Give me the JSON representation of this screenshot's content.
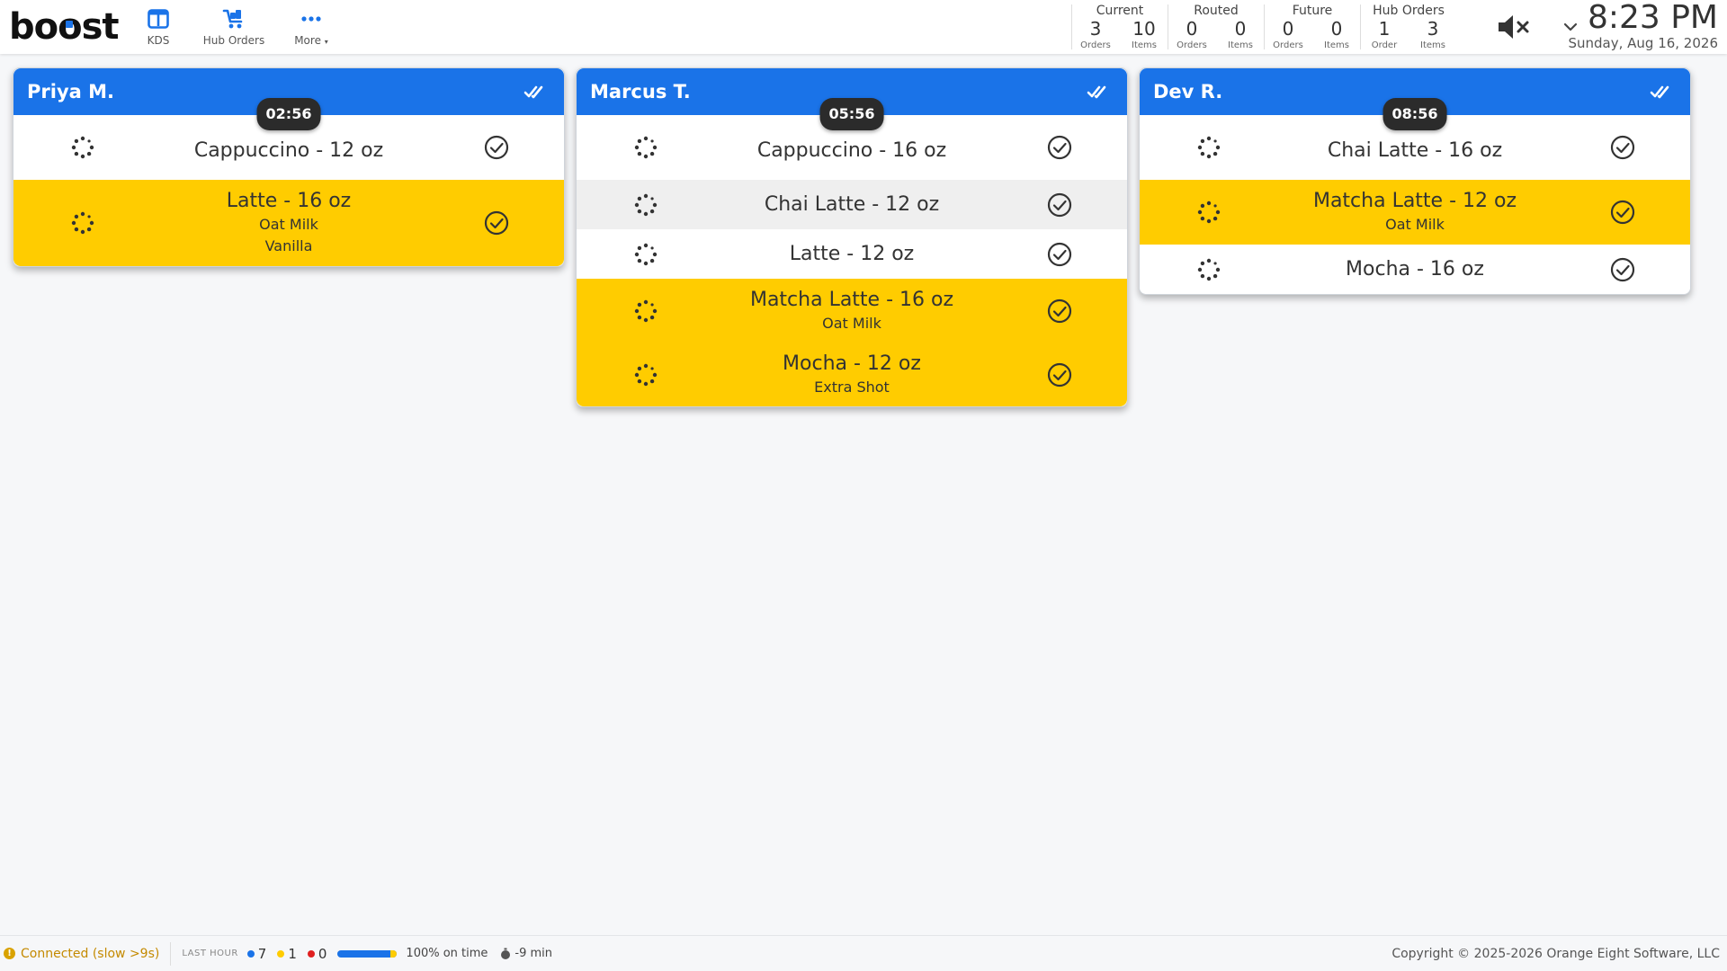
{
  "brand": {
    "logo_prefix": "b",
    "logo_o1": "o",
    "logo_o2": "o",
    "logo_suffix": "st",
    "accent": "#1a73e8"
  },
  "nav": [
    {
      "label": "KDS",
      "icon": "kds-icon"
    },
    {
      "label": "Hub Orders",
      "icon": "cart-icon"
    },
    {
      "label": "More",
      "icon": "more-dots-icon",
      "has_caret": true
    }
  ],
  "stats": {
    "current": {
      "title": "Current",
      "orders": "3",
      "orders_label": "Orders",
      "items": "10",
      "items_label": "Items"
    },
    "routed": {
      "title": "Routed",
      "orders": "0",
      "orders_label": "Orders",
      "items": "0",
      "items_label": "Items"
    },
    "future": {
      "title": "Future",
      "orders": "0",
      "orders_label": "Orders",
      "items": "0",
      "items_label": "Items"
    },
    "hub": {
      "title": "Hub Orders",
      "orders": "1",
      "orders_label": "Order",
      "items": "3",
      "items_label": "Items"
    }
  },
  "clock": {
    "time": "8:23 PM",
    "date": "Sunday, Aug 16, 2026"
  },
  "colors": {
    "header_blue": "#1a73e8",
    "modifier_yellow": "#ffcc00",
    "alt_row": "#efefef",
    "timer_bg": "#2b2b2b"
  },
  "orders": [
    {
      "name": "Priya M.",
      "timer": "02:56",
      "items": [
        {
          "name": "Cappuccino - 12 oz",
          "mods": [],
          "style": "plain"
        },
        {
          "name": "Latte - 16 oz",
          "mods": [
            "Oat Milk",
            "Vanilla"
          ],
          "style": "mod"
        }
      ]
    },
    {
      "name": "Marcus T.",
      "timer": "05:56",
      "items": [
        {
          "name": "Cappuccino - 16 oz",
          "mods": [],
          "style": "plain"
        },
        {
          "name": "Chai Latte - 12 oz",
          "mods": [],
          "style": "alt"
        },
        {
          "name": "Latte - 12 oz",
          "mods": [],
          "style": "plain"
        },
        {
          "name": "Matcha Latte - 16 oz",
          "mods": [
            "Oat Milk"
          ],
          "style": "mod"
        },
        {
          "name": "Mocha - 12 oz",
          "mods": [
            "Extra Shot"
          ],
          "style": "mod"
        }
      ]
    },
    {
      "name": "Dev R.",
      "timer": "08:56",
      "items": [
        {
          "name": "Chai Latte - 16 oz",
          "mods": [],
          "style": "plain"
        },
        {
          "name": "Matcha Latte - 12 oz",
          "mods": [
            "Oat Milk"
          ],
          "style": "mod"
        },
        {
          "name": "Mocha - 16 oz",
          "mods": [],
          "style": "plain"
        }
      ]
    }
  ],
  "footer": {
    "connection": "Connected (slow >9s)",
    "last_hour": "LAST HOUR",
    "counts": [
      {
        "value": "7",
        "color": "#1a73e8"
      },
      {
        "value": "1",
        "color": "#ffcc00"
      },
      {
        "value": "0",
        "color": "#e02020"
      }
    ],
    "on_time_fraction": 1.0,
    "on_time_label": "100% on time",
    "avg_label": "-9 min",
    "copyright": "Copyright © 2025-2026 Orange Eight Software, LLC"
  }
}
